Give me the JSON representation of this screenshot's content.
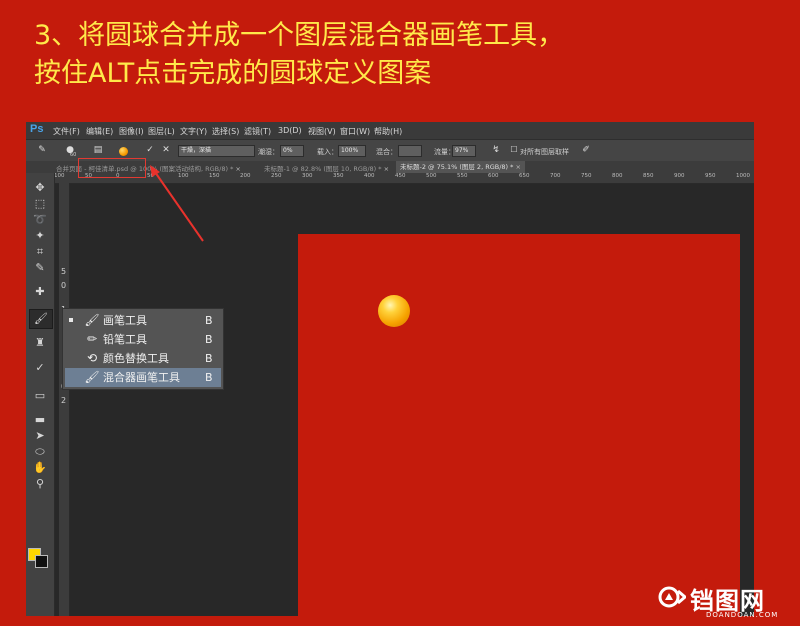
{
  "instruction": {
    "line1": "3、将圆球合并成一个图层混合器画笔工具，",
    "line2": "按住ALT点击完成的圆球定义图案"
  },
  "photoshop": {
    "logo": "Ps",
    "menu": [
      "文件(F)",
      "编辑(E)",
      "图像(I)",
      "图层(L)",
      "文字(Y)",
      "选择(S)",
      "滤镜(T)",
      "3D(D)",
      "视图(V)",
      "窗口(W)",
      "帮助(H)"
    ],
    "options": {
      "brush_size": "60",
      "mix_preset": "干燥，深描",
      "wet_label": "潮湿：",
      "wet_value": "0%",
      "load_label": "载入：",
      "load_value": "100%",
      "mix_label": "混合：",
      "flow_label": "流量：",
      "flow_value": "97%",
      "sample_all": "对所有图层取样"
    },
    "tabs": [
      {
        "label": "合并页面 - 柯佳清单.psd @ 100% (图案活动结构, RGB/8) *",
        "close": "×"
      },
      {
        "label": "未标题-1 @ 82.8% (图层 10, RGB/8) *",
        "close": "×"
      },
      {
        "label": "未标题-2 @ 75.1% (图层 2, RGB/8) *",
        "close": "×"
      }
    ],
    "ruler_top": [
      "100",
      "50",
      "0",
      "50",
      "100",
      "150",
      "200",
      "250",
      "300",
      "350",
      "400",
      "450",
      "500",
      "550",
      "600",
      "650",
      "700",
      "750",
      "800",
      "850",
      "900",
      "950",
      "1000"
    ],
    "ruler_left": [
      "5",
      "0",
      "1",
      "0",
      "2"
    ],
    "tools": [
      {
        "name": "move-tool",
        "glyph": "✥"
      },
      {
        "name": "marquee-tool",
        "glyph": "⬚"
      },
      {
        "name": "lasso-tool",
        "glyph": "➰"
      },
      {
        "name": "magic-wand-tool",
        "glyph": "✦"
      },
      {
        "name": "crop-tool",
        "glyph": "⌗"
      },
      {
        "name": "eyedropper-tool",
        "glyph": "✎"
      },
      {
        "name": "healing-brush-tool",
        "glyph": "✚"
      },
      {
        "name": "brush-tool",
        "glyph": "🖌"
      },
      {
        "name": "stamp-tool",
        "glyph": "♜"
      },
      {
        "name": "history-brush-tool",
        "glyph": "✓"
      },
      {
        "name": "eraser-tool",
        "glyph": "▭"
      },
      {
        "name": "gradient-tool",
        "glyph": "▬"
      },
      {
        "name": "path-select-tool",
        "glyph": "➤"
      },
      {
        "name": "shape-tool",
        "glyph": "⬭"
      },
      {
        "name": "hand-tool",
        "glyph": "✋"
      },
      {
        "name": "zoom-tool",
        "glyph": "⚲"
      }
    ],
    "colors": {
      "foreground": "#ffd700",
      "background": "#111111",
      "canvas": "#c41b0c"
    },
    "flyout": [
      {
        "label": "画笔工具",
        "key": "B",
        "icon": "brush-icon",
        "active": true,
        "selected": false
      },
      {
        "label": "铅笔工具",
        "key": "B",
        "icon": "pencil-icon",
        "active": false,
        "selected": false
      },
      {
        "label": "颜色替换工具",
        "key": "B",
        "icon": "color-replace-icon",
        "active": false,
        "selected": false
      },
      {
        "label": "混合器画笔工具",
        "key": "B",
        "icon": "mixer-brush-icon",
        "active": false,
        "selected": true
      }
    ]
  },
  "watermark": {
    "brand": "铛图网",
    "url": "DOANDOAN.COM"
  }
}
